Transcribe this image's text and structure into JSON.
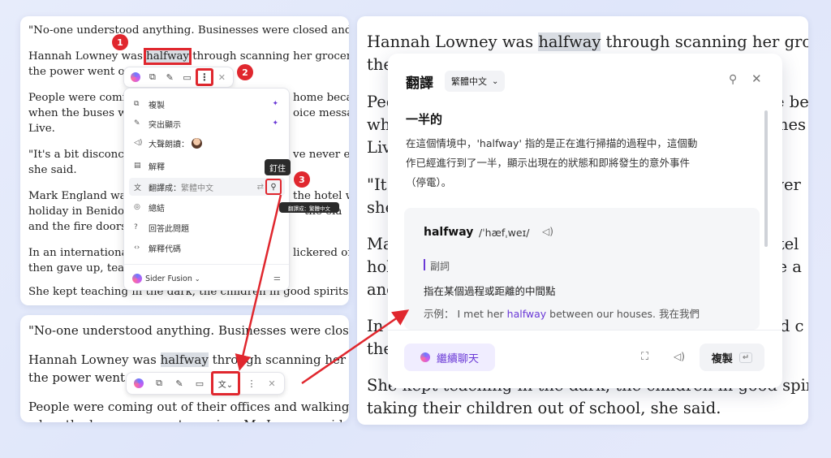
{
  "colors": {
    "accent": "#e0272e",
    "brand": "#6a39d6",
    "highlight": "#d9dde3"
  },
  "article": {
    "l1": "\"No-one understood anything. Businesses were closed and buse",
    "l2a": "Hannah Lowney was ",
    "word": "halfway",
    "l2b": " through scanning her grocery sho",
    "l3": "the power went ou",
    "l4": "People were comin",
    "l4b": "home becau",
    "l5": "when the buses we",
    "l5b": "oice messag",
    "l6": "Live.",
    "l7": "\"It's a bit disconcer",
    "l7b": "ve never exp",
    "l8": "she said.",
    "l9": "Mark England was",
    "l9b": "the hotel w",
    "l10": "holiday in Benidorm",
    "l10b": "the ela",
    "l11": "and the fire doors s",
    "l12": "In an international",
    "l12b": "lickered on",
    "l13": "then gave up, teach",
    "l14": "She kept teaching in the dark, the children in good spirits, but lo"
  },
  "toolbar_top": {
    "more_icon": "more-vertical-icon"
  },
  "menu": {
    "items": [
      {
        "label": "複製",
        "icon": "copy-icon"
      },
      {
        "label": "突出顯示",
        "icon": "highlight-icon"
      },
      {
        "label": "大聲朗讀：",
        "icon": "speaker-icon"
      },
      {
        "label": "解釋",
        "icon": "explain-icon"
      },
      {
        "label": "翻譯成：",
        "sub": "繁體中文",
        "icon": "translate-icon"
      },
      {
        "label": "總結",
        "icon": "summary-icon"
      },
      {
        "label": "回答此問題",
        "icon": "question-icon"
      },
      {
        "label": "解釋代碼",
        "icon": "code-icon"
      }
    ],
    "model": "Sider Fusion"
  },
  "tooltips": {
    "pin": "釘住",
    "translate": "翻譯成：繁體中文"
  },
  "badges": [
    "1",
    "2",
    "3"
  ],
  "article_b": {
    "l1": "\"No-one understood anything. Businesses were closed",
    "l2a": "Hannah Lowney was ",
    "word": "halfway",
    "l2b": " through scanning her g",
    "l3": "the power went",
    "l4": "People were coming out of their offices and walking ho",
    "l5": "when the buses were not running, Ms Lowney said in"
  },
  "article_c": {
    "l1a": "Hannah Lowney was ",
    "word": "halfway",
    "l1b": " through scanning her grocery",
    "l2": "the",
    "l3": "Peo",
    "l3b": "e be",
    "l4": "whe",
    "l4b": "mes",
    "l5": "Liv",
    "l6": "\"It's",
    "l6b": "ver",
    "l7": "she",
    "l8": "Ma",
    "l8b": "otel",
    "l9": "hol",
    "l9b": "ire a",
    "l10": "and",
    "l11": "In a",
    "l11b": "red c",
    "l12": "the",
    "l13": "She kept teaching in the dark, the children in good spirits, bu",
    "l14": "taking their children out of school, she said."
  },
  "panel": {
    "title": "翻譯",
    "language": "繁體中文",
    "meaning": "一半的",
    "explain1": "在這個情境中，'halfway' 指的是正在進行掃描的過程中，這個動",
    "explain2": "作已經進行到了一半，顯示出現在的狀態和即將發生的意外事件",
    "explain3": "（停電）。",
    "dict_word": "halfway",
    "phonetic": "/ˈhæfˌweɪ/",
    "pos": "副詞",
    "definition": "指在某個過程或距離的中間點",
    "example_label": "示例：",
    "example_pre": "I met her ",
    "example_word": "halfway",
    "example_post": " between our houses. 我在我們",
    "continue_chat": "繼續聊天",
    "copy": "複製"
  }
}
